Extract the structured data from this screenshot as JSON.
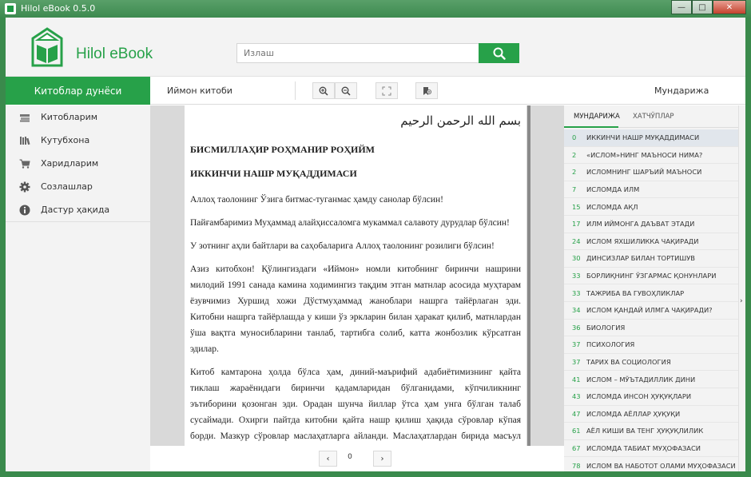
{
  "window": {
    "title": "Hilol eBook 0.5.0",
    "minimize": "—",
    "maximize": "□",
    "close": "✕"
  },
  "header": {
    "logo_text": "Hilol eBook",
    "search_placeholder": "Излаш"
  },
  "nav": {
    "section": "Китоблар дунёси",
    "book_title": "Иймон китоби",
    "contents_title": "Мундарижа"
  },
  "sidebar": {
    "items": [
      {
        "label": "Китобларим",
        "icon": "books-icon"
      },
      {
        "label": "Кутубхона",
        "icon": "library-icon"
      },
      {
        "label": "Харидларим",
        "icon": "cart-icon"
      },
      {
        "label": "Созлашлар",
        "icon": "gear-icon"
      },
      {
        "label": "Дастур ҳақида",
        "icon": "info-icon"
      }
    ]
  },
  "page": {
    "basmala": "بسم الله الرحمن الرحيم",
    "heading1": "БИСМИЛЛАҲИР РОҲМАНИР РОҲИЙМ",
    "heading2": "ИККИНЧИ НАШР МУҚАДДИМАСИ",
    "p1": "Аллоҳ таолонинг Ўзига битмас-туганмас ҳамду санолар бўлсин!",
    "p2": "Пайғамбаримиз Муҳаммад алайҳиссаломга мукаммал салавоту дурудлар бўлсин!",
    "p3": "У зотнинг аҳли байтлари ва саҳобаларига Аллоҳ таолонинг розилиги бўлсин!",
    "p4": "Азиз китобхон! Қўлингиздаги «Иймон» номли китобнинг биринчи нашрини милодий 1991 санада камина ходимингиз тақдим этган матнлар асосида муҳтарам ёзувчимиз Хуршид хожи Дўстмуҳаммад жанoблари нашрга тайёрлаган эди. Китобни нашрга тайёрлашда у киши ўз эркларин билан ҳаракат қилиб, матнлардан ўша вақтга муносибларини танлаб, тартибга солиб, катта жонбозлик кўрсатган эдилар.",
    "p5": "Китоб камтарона ҳолда бўлса ҳам, диний-маърифий адабиётимизнинг қайта тиклаш жараёнидаги биринчи қадамларидан бўлганидами, кўпчиликнинг эътиборини қозонган эди. Орадан шунча йиллар ўтса ҳам унга бўлган талаб сусаймади. Охирги пайтда китобни қайта нашр қилиш ҳақида сўровлар кўпая борди. Мазкур сўровлар маслаҳатларга айланди. Маслаҳатлардан бирида масъул вазифадор биродарлардан бирлари агар қайта нашр нияти бўлса, муқаддимани ўзгартириш лозимлигини таъкидладилар."
  },
  "pager": {
    "prev": "‹",
    "page": "0",
    "next": "›"
  },
  "contents": {
    "tab_toc": "МУНДАРИЖА",
    "tab_bookmarks": "ХАТЧЎПЛАР",
    "items": [
      {
        "num": "0",
        "title": "ИККИНЧИ НАШР МУҚАДДИМАСИ"
      },
      {
        "num": "2",
        "title": "«ИСЛОМ»НИНГ МАЪНОСИ НИМА?"
      },
      {
        "num": "2",
        "title": "ИСЛОМНИНГ ШАРЪИЙ МАЪНОСИ"
      },
      {
        "num": "7",
        "title": "ИСЛОМДА ИЛМ"
      },
      {
        "num": "15",
        "title": "ИСЛОМДА АҚЛ"
      },
      {
        "num": "17",
        "title": "ИЛМ ИЙМОНГА ДАЪВАТ ЭТАДИ"
      },
      {
        "num": "24",
        "title": "ИСЛОМ ЯХШИЛИККА ЧАҚИРАДИ"
      },
      {
        "num": "30",
        "title": "ДИНСИЗЛАР БИЛАН ТОРТИШУВ"
      },
      {
        "num": "33",
        "title": "БОРЛИҚНИНГ ЎЗГАРМАС ҚОНУНЛАРИ"
      },
      {
        "num": "33",
        "title": "ТАЖРИБА ВА ГУВОҲЛИКЛАР"
      },
      {
        "num": "34",
        "title": "ИСЛОМ ҚАНДАЙ ИЛМГА ЧАҚИРАДИ?"
      },
      {
        "num": "36",
        "title": "БИОЛОГИЯ"
      },
      {
        "num": "37",
        "title": "ПСИХОЛОГИЯ"
      },
      {
        "num": "37",
        "title": "ТАРИХ ВА СОЦИОЛОГИЯ"
      },
      {
        "num": "41",
        "title": "ИСЛОМ – МЎЪТАДИЛЛИК ДИНИ"
      },
      {
        "num": "43",
        "title": "ИСЛОМДА ИНСОН ҲУҚУҚЛАРИ"
      },
      {
        "num": "47",
        "title": "ИСЛОМДА АЁЛЛАР ҲУҚУҚИ"
      },
      {
        "num": "61",
        "title": "АЁЛ КИШИ ВА ТЕНГ ҲУҚУҚЛИЛИК"
      },
      {
        "num": "67",
        "title": "ИСЛОМДА ТАБИАТ МУҲОФАЗАСИ"
      },
      {
        "num": "78",
        "title": "ИСЛОМ ВА НАБОТОТ ОЛАМИ МУҲОФАЗАСИ"
      }
    ]
  },
  "colors": {
    "accent": "#27a149",
    "titlebar": "#3d8a4f"
  }
}
